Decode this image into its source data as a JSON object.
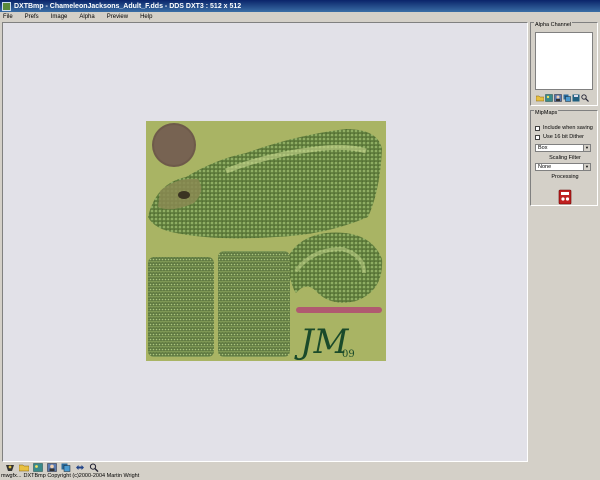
{
  "window": {
    "title": "DXTBmp - ChameleonJacksons_Adult_F.dds - DDS DXT3 : 512 x 512"
  },
  "menu": {
    "items": [
      "File",
      "Prefs",
      "Image",
      "Alpha",
      "Preview",
      "Help"
    ]
  },
  "alpha_panel": {
    "title": "Alpha Channel"
  },
  "mipmaps_panel": {
    "title": "MipMaps",
    "include_when_saving": "Include when saving",
    "use_16bit_dither": "Use 16 bit Dither",
    "filter_value": "Box",
    "scaling_filter_label": "Scaling Filter",
    "scaling_value": "None",
    "processing_label": "Processing"
  },
  "texture": {
    "signature_text": "JM",
    "year_text": "09"
  },
  "status": {
    "left": "mwgfx...",
    "right": "DXTBmp Copyright (c)2000-2004 Martin Wright"
  },
  "colors": {
    "title_bar": "#0a246a",
    "canvas": "#e2e1e8",
    "chrome": "#d4d0c8",
    "texture_bg": "#a4b060"
  },
  "icons": {
    "alpha_tools": [
      "folder-open-icon",
      "image-icon",
      "user-icon",
      "copy-icon",
      "save-icon",
      "magnify-icon"
    ],
    "bottom_tools": [
      "view-icon",
      "folder-icon",
      "image-icon",
      "user-icon",
      "copy-icon",
      "resize-icon",
      "zoom-icon"
    ]
  }
}
